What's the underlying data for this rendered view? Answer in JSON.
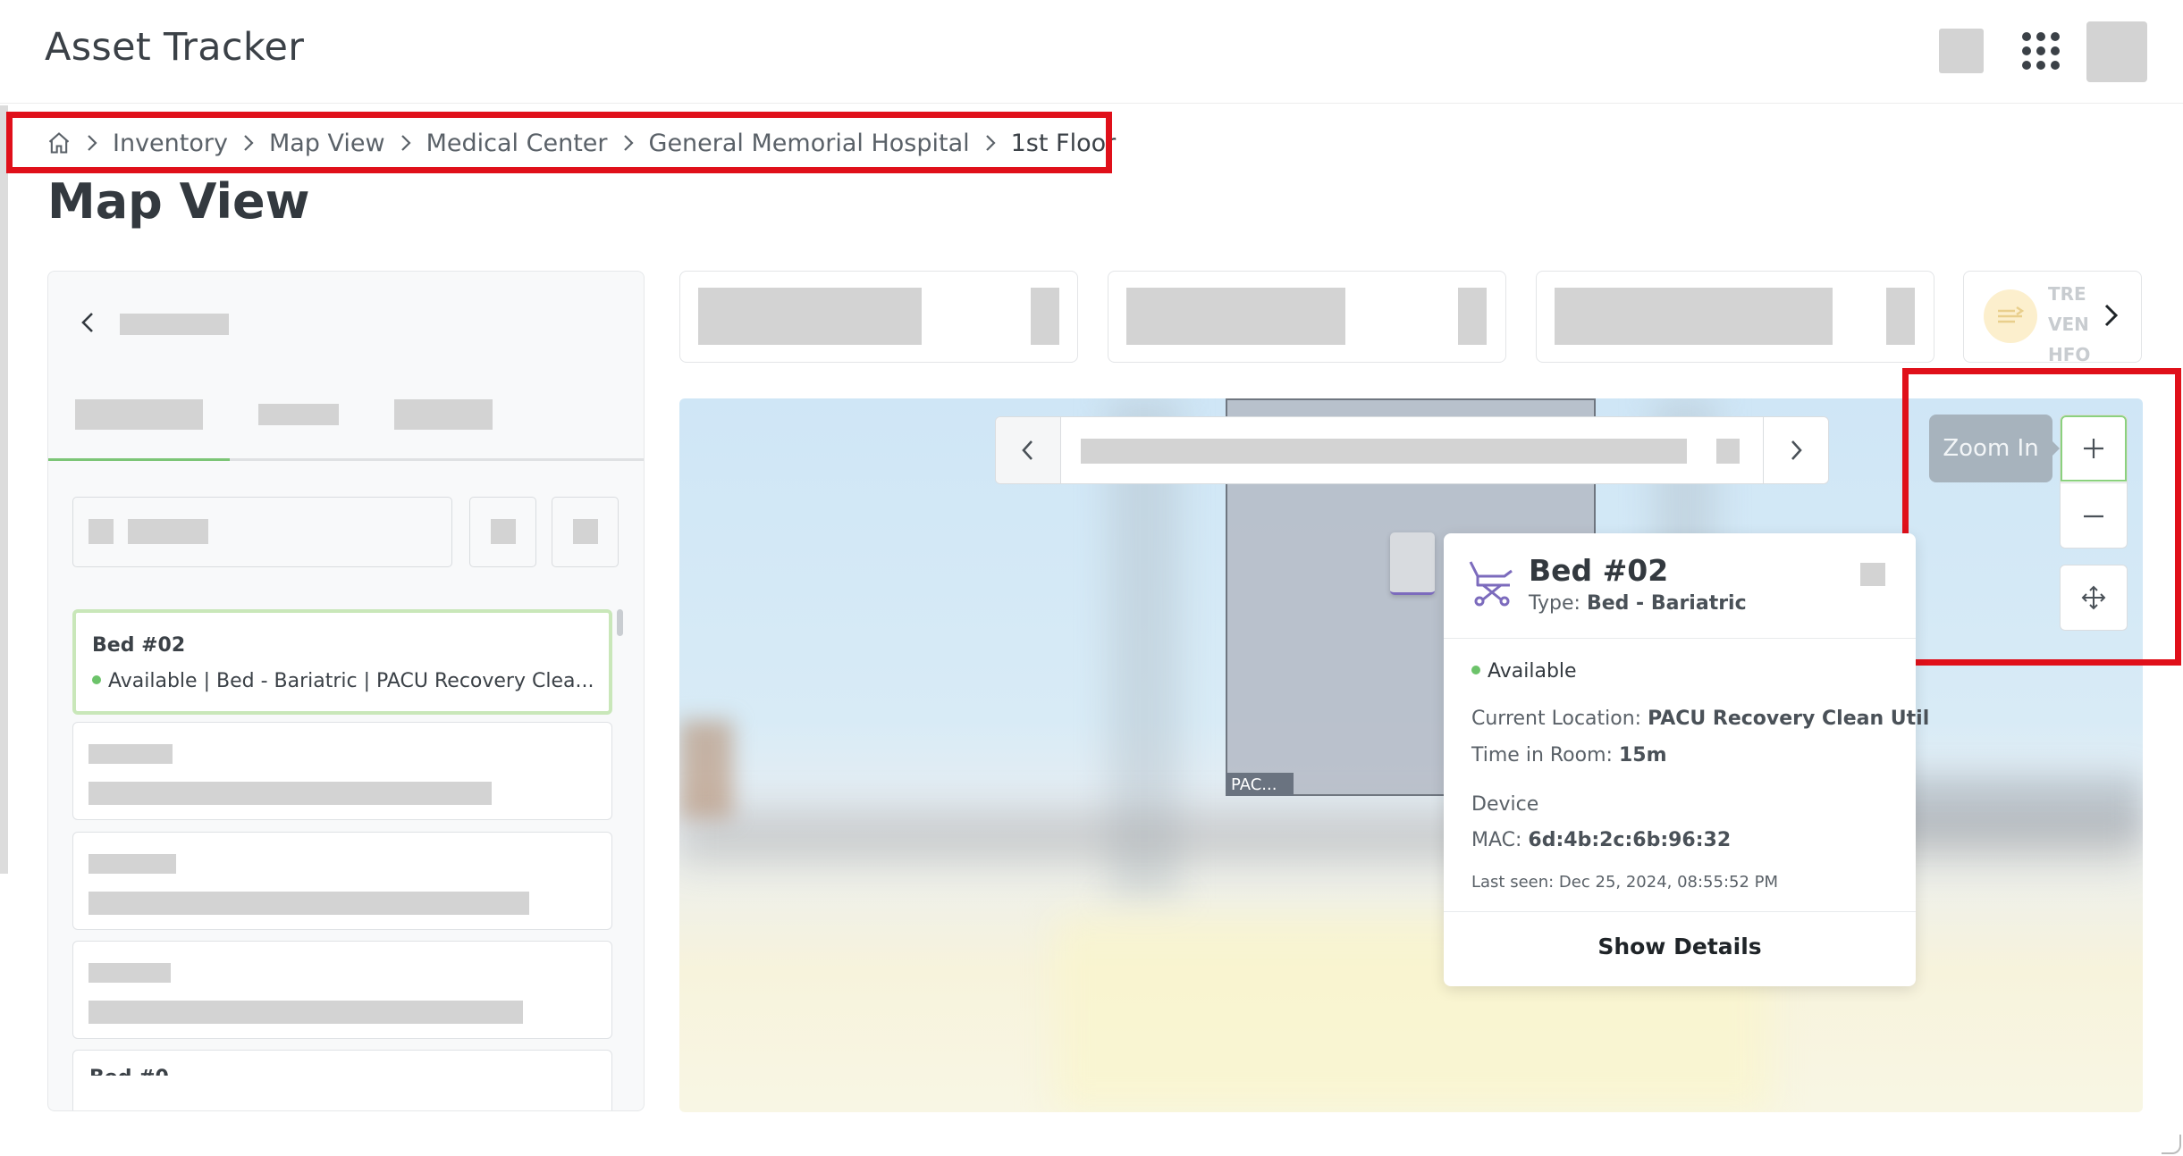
{
  "header": {
    "app_title": "Asset Tracker",
    "icons": [
      "apps-grid-icon"
    ]
  },
  "breadcrumb": {
    "home_icon": "home-icon",
    "items": [
      "Inventory",
      "Map View",
      "Medical Center",
      "General Memorial Hospital",
      "1st Floor"
    ]
  },
  "page": {
    "title": "Map View"
  },
  "list": {
    "selected_item": {
      "name": "Bed #02",
      "status": "Available",
      "details": "| Bed - Bariatric | PACU Recovery Clea..."
    },
    "partial_item_name": "Bed #0"
  },
  "metrics": {
    "partial_card_text": [
      "TRE",
      "VEN",
      "HFO"
    ]
  },
  "map": {
    "room_label": "PAC...",
    "zoom_tooltip": "Zoom In",
    "controls": [
      "plus-icon",
      "minus-icon",
      "move-icon"
    ]
  },
  "popup": {
    "title": "Bed #02",
    "type_label": "Type:",
    "type_value": "Bed - Bariatric",
    "status": "Available",
    "location_label": "Current Location:",
    "location_value": "PACU Recovery Clean Util",
    "time_label": "Time in Room:",
    "time_value": "15m",
    "device_label": "Device",
    "mac_label": "MAC:",
    "mac_value": "6d:4b:2c:6b:96:32",
    "last_seen": "Last seen: Dec 25, 2024, 08:55:52 PM",
    "show_details": "Show Details"
  },
  "colors": {
    "accent_green": "#7cc576",
    "status_green": "#6cc36a",
    "highlight_red": "#e0101a",
    "bed_icon_purple": "#7c6bbd"
  }
}
